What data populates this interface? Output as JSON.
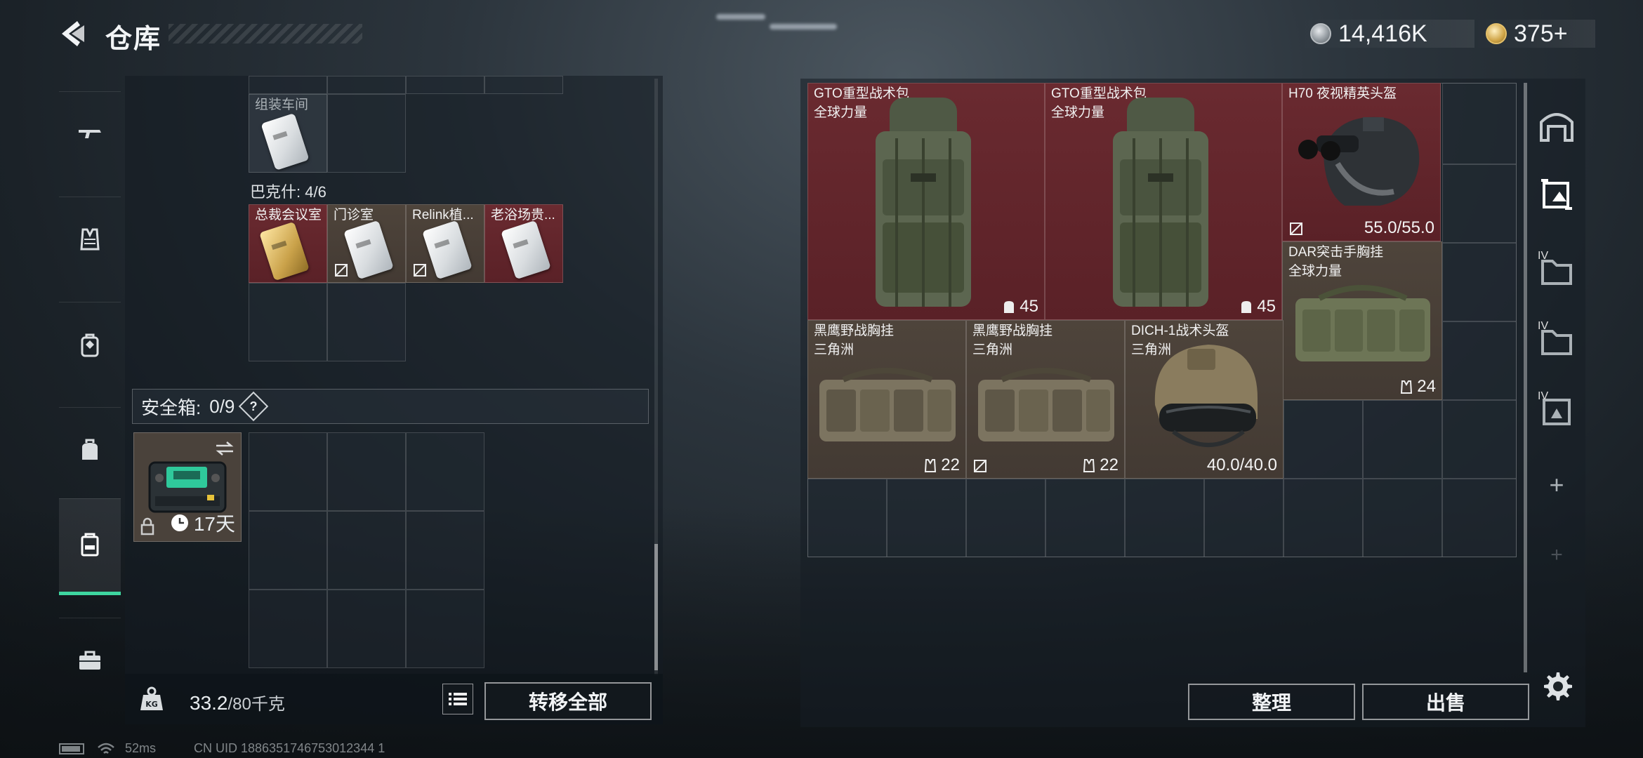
{
  "header": {
    "title": "仓库",
    "currency_silver": "14,416K",
    "currency_gold": "375+"
  },
  "nav": {
    "items": [
      "rifle-icon",
      "vest-icon",
      "backpack-icon",
      "pack-icon",
      "container-icon",
      "briefcase-icon"
    ],
    "active_index": 4
  },
  "left": {
    "top_item_label": "组装车间",
    "section_label": "巴克什: 4/6",
    "keys": [
      {
        "label": "总裁会议室",
        "flag": false
      },
      {
        "label": "门诊室",
        "flag": true
      },
      {
        "label": "Relink植...",
        "flag": true
      },
      {
        "label": "老浴场贵...",
        "flag": false
      }
    ],
    "safebox_title": "安全箱:",
    "safebox_count": "0/9",
    "safebox_help": "?",
    "safebox_duration": "17天",
    "weight_value": "33.2",
    "weight_max": "/80千克",
    "transfer_all_label": "转移全部"
  },
  "right": {
    "items": [
      {
        "name": "GTO重型战术包",
        "sub": "全球力量",
        "value": "45"
      },
      {
        "name": "GTO重型战术包",
        "sub": "全球力量",
        "value": "45"
      },
      {
        "name": "H70 夜视精英头盔",
        "sub": "",
        "value": "55.0/55.0"
      },
      {
        "name": "DAR突击手胸挂",
        "sub": "全球力量",
        "value": "24"
      },
      {
        "name": "黑鹰野战胸挂",
        "sub": "三角洲",
        "value": "22"
      },
      {
        "name": "黑鹰野战胸挂",
        "sub": "三角洲",
        "value": "22"
      },
      {
        "name": "DICH-1战术头盔",
        "sub": "三角洲",
        "value": "40.0/40.0"
      }
    ],
    "sort_label": "整理",
    "sell_label": "出售",
    "add_label": "+",
    "tier_labels": [
      "IV",
      "IV",
      "IV"
    ]
  },
  "status": {
    "ping": "52ms",
    "uid": "CN UID 1886351746753012344 1"
  },
  "colors": {
    "accent": "#3ed6a0",
    "item_red": "#6a2a30",
    "item_brown": "#4e443b"
  }
}
